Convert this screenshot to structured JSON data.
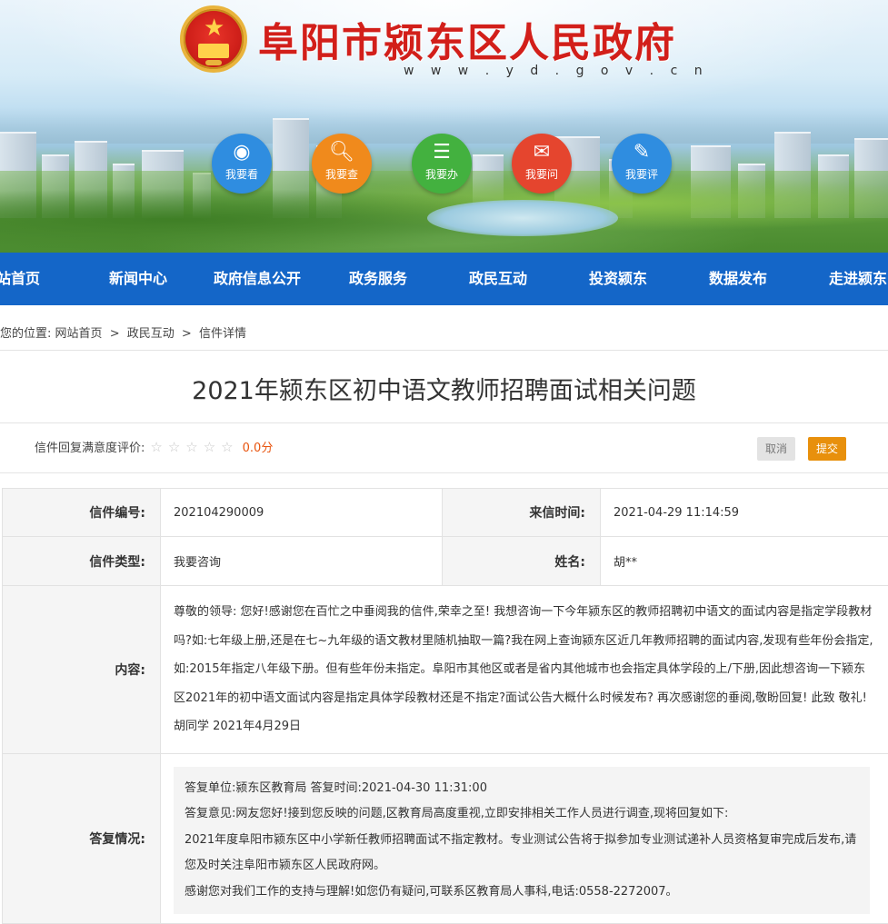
{
  "header": {
    "site_title": "阜阳市颍东区人民政府",
    "site_url": "w w w . y d . g o v . c n",
    "quick_links": [
      {
        "label": "我要看",
        "icon": "eye-icon"
      },
      {
        "label": "我要查",
        "icon": "search-document-icon"
      },
      {
        "label": "我要办",
        "icon": "clipboard-icon"
      },
      {
        "label": "我要问",
        "icon": "chat-icon"
      },
      {
        "label": "我要评",
        "icon": "edit-icon"
      }
    ]
  },
  "nav": {
    "items": [
      "站首页",
      "新闻中心",
      "政府信息公开",
      "政务服务",
      "政民互动",
      "投资颍东",
      "数据发布",
      "走进颍东"
    ]
  },
  "breadcrumb": {
    "prefix": "您的位置:",
    "items": [
      "网站首页",
      "政民互动",
      "信件详情"
    ],
    "separator": ">"
  },
  "letter": {
    "title": "2021年颍东区初中语文教师招聘面试相关问题",
    "rating_label": "信件回复满意度评价:",
    "stars": "☆☆☆☆☆",
    "score": "0.0分",
    "cancel_label": "取消",
    "submit_label": "提交",
    "fields": {
      "number_label": "信件编号:",
      "number": "202104290009",
      "time_label": "来信时间:",
      "time": "2021-04-29 11:14:59",
      "type_label": "信件类型:",
      "type": "我要咨询",
      "name_label": "姓名:",
      "name": "胡**",
      "content_label": "内容:",
      "content": "尊敬的领导: 您好!感谢您在百忙之中垂阅我的信件,荣幸之至! 我想咨询一下今年颍东区的教师招聘初中语文的面试内容是指定学段教材吗?如:七年级上册,还是在七~九年级的语文教材里随机抽取一篇?我在网上查询颍东区近几年教师招聘的面试内容,发现有些年份会指定,如:2015年指定八年级下册。但有些年份未指定。阜阳市其他区或者是省内其他城市也会指定具体学段的上/下册,因此想咨询一下颍东区2021年的初中语文面试内容是指定具体学段教材还是不指定?面试公告大概什么时候发布? 再次感谢您的垂阅,敬盼回复! 此致 敬礼! 胡同学 2021年4月29日",
      "reply_label": "答复情况:"
    },
    "reply": {
      "unit_line": "答复单位:颍东区教育局  答复时间:2021-04-30 11:31:00",
      "opinion_line": "答复意见:网友您好!接到您反映的问题,区教育局高度重视,立即安排相关工作人员进行调查,现将回复如下:",
      "body_line": "2021年度阜阳市颍东区中小学新任教师招聘面试不指定教材。专业测试公告将于拟参加专业测试递补人员资格复审完成后发布,请您及时关注阜阳市颍东区人民政府网。",
      "thanks_line": "感谢您对我们工作的支持与理解!如您仍有疑问,可联系区教育局人事科,电话:0558-2272007。"
    }
  },
  "colors": {
    "nav_bg": "#1466c8",
    "title_red": "#d21f1a",
    "submit_orange": "#e8900c",
    "score_orange": "#e8540e"
  }
}
